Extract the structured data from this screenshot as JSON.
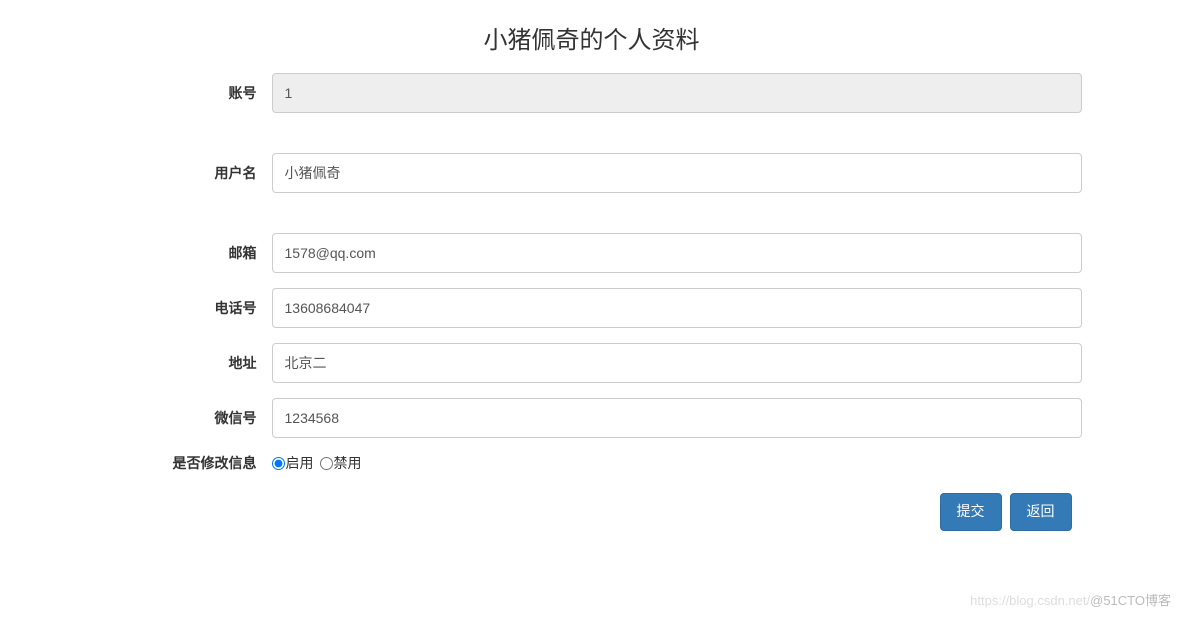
{
  "title": "小猪佩奇的个人资料",
  "fields": {
    "account": {
      "label": "账号",
      "value": "1"
    },
    "username": {
      "label": "用户名",
      "value": "小猪佩奇"
    },
    "email": {
      "label": "邮箱",
      "value": "1578@qq.com"
    },
    "phone": {
      "label": "电话号",
      "value": "13608684047"
    },
    "address": {
      "label": "地址",
      "value": "北京二"
    },
    "wechat": {
      "label": "微信号",
      "value": "1234568"
    },
    "modify": {
      "label": "是否修改信息",
      "enable_label": "启用",
      "disable_label": "禁用"
    }
  },
  "buttons": {
    "submit": "提交",
    "back": "返回"
  },
  "watermark": {
    "faint": "https://blog.csdn.net/",
    "text": "@51CTO博客"
  }
}
